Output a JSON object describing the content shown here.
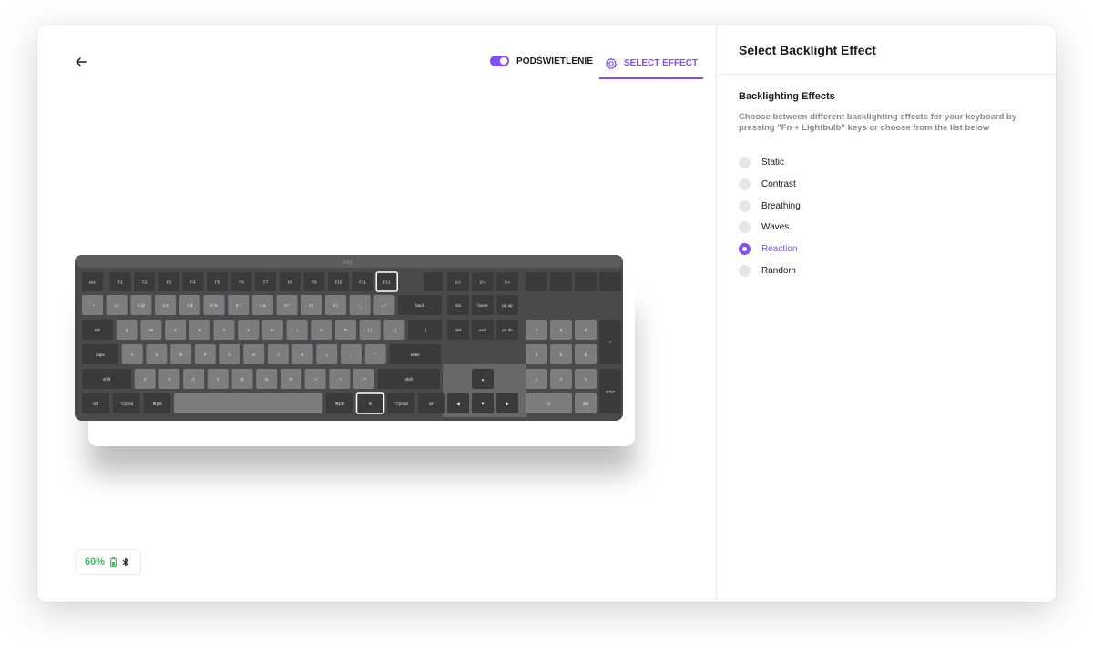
{
  "window": {
    "traffic_lights": [
      "close",
      "minimize",
      "maximize"
    ]
  },
  "header": {
    "back_icon": "arrow-left-icon",
    "backlight_toggle_label": "PODŚWIETLENIE",
    "backlight_toggle_on": true,
    "select_effect_tab_label": "SELECT EFFECT",
    "select_effect_icon": "gear-icon"
  },
  "keyboard": {
    "brand_label": "logi",
    "fn_row": [
      "esc",
      "F1",
      "F2",
      "F3",
      "F4",
      "F5",
      "F6",
      "F7",
      "F8",
      "F9",
      "F10",
      "F11",
      "F12"
    ],
    "number_row": [
      "` ~",
      "1 !",
      "2 @",
      "3 #",
      "4 $",
      "5 %",
      "6 ^",
      "7 &",
      "8 *",
      "9 (",
      "0 )",
      "- _",
      "= +",
      "back"
    ],
    "top_row": [
      "tab",
      "Q",
      "W",
      "E",
      "R",
      "T",
      "Y",
      "U",
      "I",
      "O",
      "P",
      "[ {",
      "] }",
      "\\ |"
    ],
    "home_row": [
      "caps",
      "A",
      "S",
      "D",
      "F",
      "G",
      "H",
      "J",
      "K",
      "L",
      "; :",
      "' \"",
      "enter"
    ],
    "bottom_row": [
      "shift",
      "Z",
      "X",
      "C",
      "V",
      "B",
      "N",
      "M",
      ", <",
      ". >",
      "/ ?",
      "shift"
    ],
    "space_row": [
      "ctrl",
      "⌥|cmd",
      "⌘|alt",
      "",
      "⌘|alt",
      "fn",
      "⌥|cmd",
      "ctrl"
    ],
    "nav_top": [
      "1▭",
      "2▭",
      "3▭"
    ],
    "nav_mid": [
      "ins",
      "home",
      "pg up",
      "del",
      "end",
      "pg dn"
    ],
    "arrows": [
      "▲",
      "◀",
      "▼",
      "▶"
    ],
    "numpad_labels": [
      "7",
      "8",
      "9",
      "4",
      "5",
      "6",
      "1",
      "2",
      "3",
      "0",
      "enter",
      "del"
    ]
  },
  "battery": {
    "percent_text": "60%",
    "battery_icon": "battery-icon",
    "bluetooth_icon": "bluetooth-icon"
  },
  "panel": {
    "title": "Select Backlight Effect",
    "section_heading": "Backlighting Effects",
    "description": "Choose between different backlighting effects for your keyboard by pressing \"Fn + Lightbulb\" keys or choose from the list below",
    "effects": [
      {
        "label": "Static",
        "selected": false
      },
      {
        "label": "Contrast",
        "selected": false
      },
      {
        "label": "Breathing",
        "selected": false
      },
      {
        "label": "Waves",
        "selected": false
      },
      {
        "label": "Reaction",
        "selected": true
      },
      {
        "label": "Random",
        "selected": false
      }
    ]
  },
  "colors": {
    "accent": "#814efa",
    "battery_green": "#3ec064",
    "keyboard_body": "#4a4a4c",
    "key_dark": "#3a3a3c",
    "key_light": "#7d7d80"
  }
}
